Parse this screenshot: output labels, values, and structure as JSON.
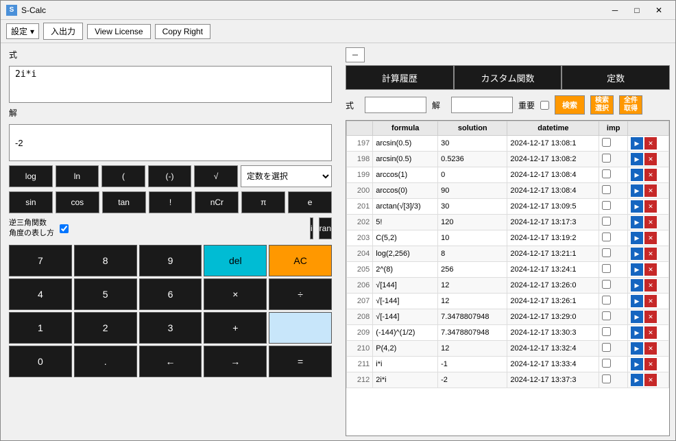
{
  "window": {
    "title": "S-Calc",
    "close_btn": "✕",
    "minimize_btn": "─",
    "maximize_btn": "□"
  },
  "toolbar": {
    "settings_label": "設定",
    "io_label": "入出力",
    "license_label": "View License",
    "copyright_label": "Copy Right"
  },
  "left": {
    "formula_label": "式",
    "formula_value": "2i*i",
    "result_label": "解",
    "result_value": "-2",
    "func_buttons": [
      "log",
      "ln",
      "(",
      "(-)",
      "√"
    ],
    "const_select_label": "定数を選択",
    "trig_row1": [
      "sin",
      "cos",
      "tan",
      "!",
      "nCr"
    ],
    "trig_row2": [
      "π",
      "e"
    ],
    "trig_label": "逆三角関数\n角度の表し方",
    "special_btns": [
      "i",
      "ran"
    ],
    "num_grid": [
      "7",
      "8",
      "9",
      "del",
      "AC",
      "4",
      "5",
      "6",
      "×",
      "÷",
      "1",
      "2",
      "3",
      "+",
      "",
      "0",
      ".",
      "←",
      "→",
      "="
    ]
  },
  "right": {
    "toggle_label": "－",
    "tab1": "計算履歴",
    "tab2": "カスタム関数",
    "tab3": "定数",
    "search_formula_label": "式",
    "search_solution_label": "解",
    "search_important_label": "重要",
    "search_btn_label": "検索",
    "check_btn_label": "検索\n選択",
    "all_btn_label": "全件\n取得",
    "table": {
      "headers": [
        "",
        "formula",
        "solution",
        "datetime",
        "imp",
        ""
      ],
      "rows": [
        {
          "num": "197",
          "formula": "arcsin(0.5)",
          "solution": "30",
          "datetime": "2024-12-17 13:08:1",
          "imp": false
        },
        {
          "num": "198",
          "formula": "arcsin(0.5)",
          "solution": "0.5236",
          "datetime": "2024-12-17 13:08:2",
          "imp": false
        },
        {
          "num": "199",
          "formula": "arccos(1)",
          "solution": "0",
          "datetime": "2024-12-17 13:08:4",
          "imp": false
        },
        {
          "num": "200",
          "formula": "arccos(0)",
          "solution": "90",
          "datetime": "2024-12-17 13:08:4",
          "imp": false
        },
        {
          "num": "201",
          "formula": "arctan(√[3]/3)",
          "solution": "30",
          "datetime": "2024-12-17 13:09:5",
          "imp": false
        },
        {
          "num": "202",
          "formula": "5!",
          "solution": "120",
          "datetime": "2024-12-17 13:17:3",
          "imp": false
        },
        {
          "num": "203",
          "formula": "C(5,2)",
          "solution": "10",
          "datetime": "2024-12-17 13:19:2",
          "imp": false
        },
        {
          "num": "204",
          "formula": "log(2,256)",
          "solution": "8",
          "datetime": "2024-12-17 13:21:1",
          "imp": false
        },
        {
          "num": "205",
          "formula": "2^(8)",
          "solution": "256",
          "datetime": "2024-12-17 13:24:1",
          "imp": false
        },
        {
          "num": "206",
          "formula": "√[144]",
          "solution": "12",
          "datetime": "2024-12-17 13:26:0",
          "imp": false
        },
        {
          "num": "207",
          "formula": "√[-144]",
          "solution": "12",
          "datetime": "2024-12-17 13:26:1",
          "imp": false
        },
        {
          "num": "208",
          "formula": "√[-144]",
          "solution": "7.3478807948",
          "datetime": "2024-12-17 13:29:0",
          "imp": false
        },
        {
          "num": "209",
          "formula": "(-144)^(1/2)",
          "solution": "7.3478807948",
          "datetime": "2024-12-17 13:30:3",
          "imp": false
        },
        {
          "num": "210",
          "formula": "P(4,2)",
          "solution": "12",
          "datetime": "2024-12-17 13:32:4",
          "imp": false
        },
        {
          "num": "211",
          "formula": "i*i",
          "solution": "-1",
          "datetime": "2024-12-17 13:33:4",
          "imp": false
        },
        {
          "num": "212",
          "formula": "2i*i",
          "solution": "-2",
          "datetime": "2024-12-17 13:37:3",
          "imp": false
        }
      ]
    }
  }
}
